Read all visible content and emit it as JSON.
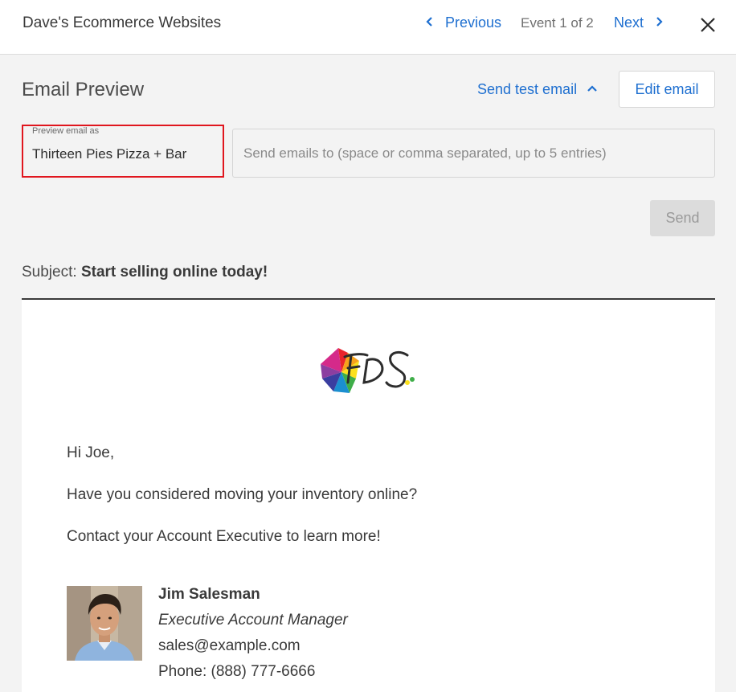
{
  "header": {
    "title": "Dave's Ecommerce Websites",
    "previous_label": "Previous",
    "event_counter": "Event 1 of 2",
    "next_label": "Next"
  },
  "panel": {
    "title": "Email Preview",
    "send_test_label": "Send test email",
    "edit_label": "Edit email"
  },
  "preview_as": {
    "label": "Preview email as",
    "value": "Thirteen Pies Pizza + Bar"
  },
  "recipients": {
    "placeholder": "Send emails to (space or comma separated, up to 5 entries)",
    "value": ""
  },
  "send_label": "Send",
  "subject": {
    "prefix": "Subject:",
    "value": "Start selling online today!"
  },
  "email": {
    "greeting": "Hi Joe,",
    "paragraph_1": "Have you considered moving your inventory online?",
    "paragraph_2": "Contact your Account Executive to learn more!",
    "signature": {
      "name": "Jim Salesman",
      "role": "Executive Account Manager",
      "email": "sales@example.com",
      "phone": "Phone: (888) 777-6666"
    }
  },
  "colors": {
    "accent": "#1e6fd0",
    "highlight_border": "#e0161e",
    "background": "#f3f3f3"
  },
  "icons": [
    "chevron-left-icon",
    "chevron-right-icon",
    "close-icon",
    "chevron-up-icon",
    "company-logo",
    "avatar-photo"
  ]
}
